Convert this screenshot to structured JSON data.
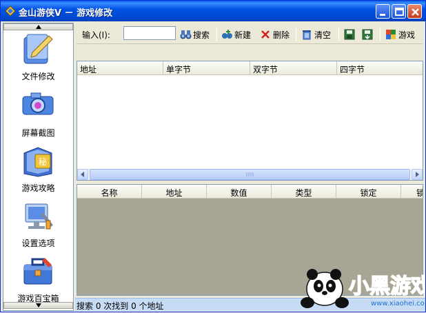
{
  "window": {
    "title": "金山游侠V － 游戏修改"
  },
  "sidebar": {
    "items": [
      {
        "label": "文件修改",
        "icon": "file-edit-icon"
      },
      {
        "label": "屏幕截图",
        "icon": "camera-icon"
      },
      {
        "label": "游戏攻略",
        "icon": "strategy-book-icon"
      },
      {
        "label": "设置选项",
        "icon": "settings-icon"
      },
      {
        "label": "游戏百宝箱",
        "icon": "toolbox-icon"
      }
    ]
  },
  "toolbar": {
    "input_label": "输入(I):",
    "input_value": "",
    "search_label": "搜索",
    "new_label": "新建",
    "delete_label": "删除",
    "clear_label": "清空",
    "game_label": "游戏"
  },
  "upper_table": {
    "columns": [
      "地址",
      "单字节",
      "双字节",
      "四字节"
    ]
  },
  "lower_table": {
    "columns": [
      "名称",
      "地址",
      "数值",
      "类型",
      "锁定",
      "锁"
    ]
  },
  "status": {
    "text": "搜索 0 次找到 0 个地址"
  },
  "watermark": {
    "brand": "小黑游戏",
    "url": "www.xiaohei.com"
  },
  "colors": {
    "titlebar": "#0054e3",
    "accent": "#3b8bff",
    "status_bg": "#c6dcf5"
  }
}
